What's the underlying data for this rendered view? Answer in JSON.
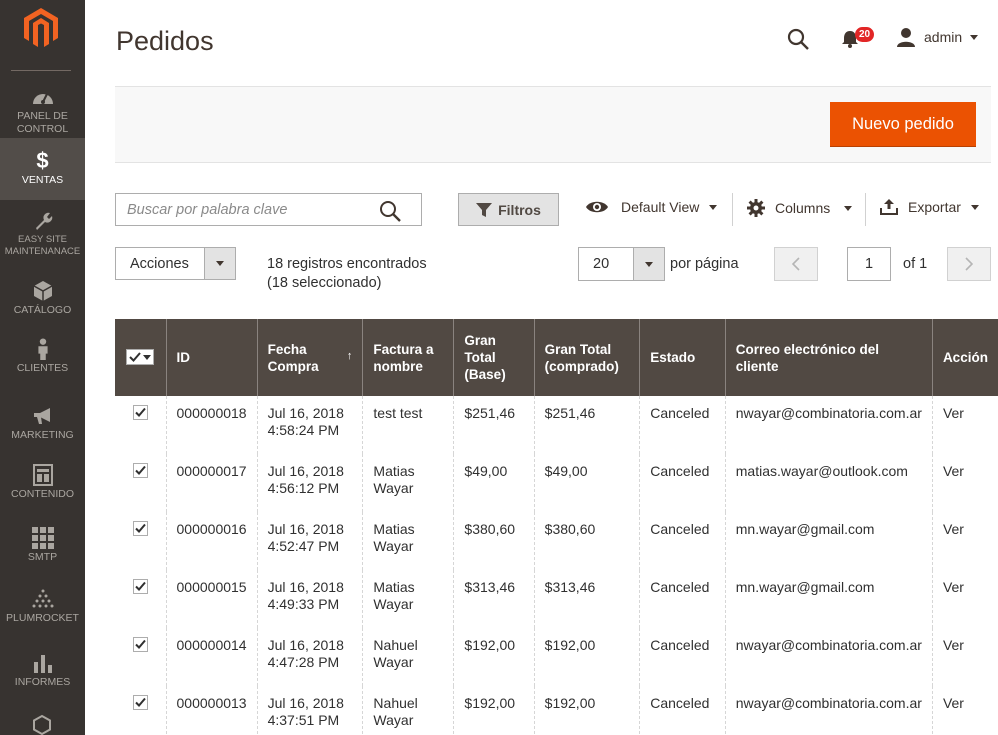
{
  "sidebar": {
    "items": [
      {
        "label": "PANEL DE CONTROL",
        "icon": "dashboard-icon"
      },
      {
        "label": "VENTAS",
        "icon": "dollar-icon",
        "active": true
      },
      {
        "label": "EASY SITE MAINTENANACE",
        "icon": "wrench-icon"
      },
      {
        "label": "CATÁLOGO",
        "icon": "box-icon"
      },
      {
        "label": "CLIENTES",
        "icon": "person-icon"
      },
      {
        "label": "MARKETING",
        "icon": "megaphone-icon"
      },
      {
        "label": "CONTENIDO",
        "icon": "layout-icon"
      },
      {
        "label": "SMTP",
        "icon": "grid-icon"
      },
      {
        "label": "PLUMROCKET",
        "icon": "pyramid-icon"
      },
      {
        "label": "INFORMES",
        "icon": "bar-chart-icon"
      }
    ]
  },
  "header": {
    "title": "Pedidos",
    "notifications": "20",
    "user": "admin"
  },
  "actions": {
    "new_order": "Nuevo pedido"
  },
  "toolbar": {
    "search_placeholder": "Buscar por palabra clave",
    "filters": "Filtros",
    "view": "Default View",
    "columns": "Columns",
    "export": "Exportar",
    "mass_actions": "Acciones",
    "records_line1": "18 registros encontrados",
    "records_line2": "(18 seleccionado)",
    "per_page_value": "20",
    "per_page_label": "por página",
    "page": "1",
    "of_pages": "of 1"
  },
  "grid": {
    "columns": [
      "ID",
      "Fecha Compra",
      "Factura a nombre",
      "Gran Total (Base)",
      "Gran Total (comprado)",
      "Estado",
      "Correo electrónico del cliente",
      "Acción"
    ],
    "rows": [
      {
        "id": "000000018",
        "date1": "Jul 16, 2018",
        "date2": "4:58:24 PM",
        "name1": "test test",
        "name2": "",
        "base": "$251,46",
        "purchased": "$251,46",
        "status": "Canceled",
        "email": "nwayar@combinatoria.com.ar",
        "action": "Ver"
      },
      {
        "id": "000000017",
        "date1": "Jul 16, 2018",
        "date2": "4:56:12 PM",
        "name1": "Matias",
        "name2": "Wayar",
        "base": "$49,00",
        "purchased": "$49,00",
        "status": "Canceled",
        "email": "matias.wayar@outlook.com",
        "action": "Ver"
      },
      {
        "id": "000000016",
        "date1": "Jul 16, 2018",
        "date2": "4:52:47 PM",
        "name1": "Matias",
        "name2": "Wayar",
        "base": "$380,60",
        "purchased": "$380,60",
        "status": "Canceled",
        "email": "mn.wayar@gmail.com",
        "action": "Ver"
      },
      {
        "id": "000000015",
        "date1": "Jul 16, 2018",
        "date2": "4:49:33 PM",
        "name1": "Matias",
        "name2": "Wayar",
        "base": "$313,46",
        "purchased": "$313,46",
        "status": "Canceled",
        "email": "mn.wayar@gmail.com",
        "action": "Ver"
      },
      {
        "id": "000000014",
        "date1": "Jul 16, 2018",
        "date2": "4:47:28 PM",
        "name1": "Nahuel",
        "name2": "Wayar",
        "base": "$192,00",
        "purchased": "$192,00",
        "status": "Canceled",
        "email": "nwayar@combinatoria.com.ar",
        "action": "Ver"
      },
      {
        "id": "000000013",
        "date1": "Jul 16, 2018",
        "date2": "4:37:51 PM",
        "name1": "Nahuel",
        "name2": "Wayar",
        "base": "$192,00",
        "purchased": "$192,00",
        "status": "Canceled",
        "email": "nwayar@combinatoria.com.ar",
        "action": "Ver"
      }
    ]
  },
  "colors": {
    "sidebar_bg": "#373330",
    "sidebar_active": "#524d49",
    "accent": "#eb5202",
    "grid_header": "#514943",
    "link": "#007bdb",
    "badge": "#e22626"
  }
}
